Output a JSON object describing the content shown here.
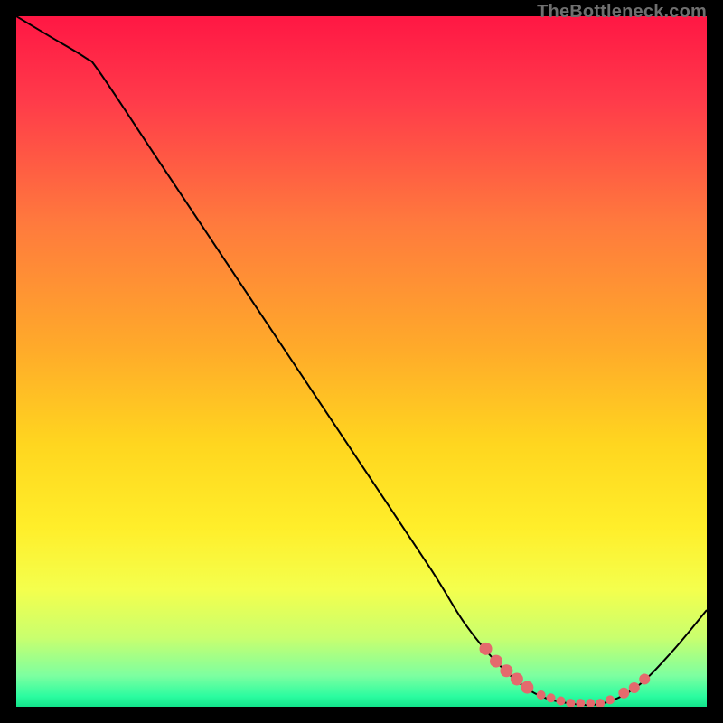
{
  "watermark": "TheBottleneck.com",
  "chart_data": {
    "type": "line",
    "title": "",
    "xlabel": "",
    "ylabel": "",
    "xlim": [
      0,
      100
    ],
    "ylim": [
      0,
      100
    ],
    "grid": false,
    "curve": [
      {
        "x": 0,
        "y": 100
      },
      {
        "x": 5,
        "y": 97
      },
      {
        "x": 10,
        "y": 94
      },
      {
        "x": 12,
        "y": 92
      },
      {
        "x": 20,
        "y": 80
      },
      {
        "x": 30,
        "y": 65
      },
      {
        "x": 40,
        "y": 50
      },
      {
        "x": 50,
        "y": 35
      },
      {
        "x": 60,
        "y": 20
      },
      {
        "x": 65,
        "y": 12
      },
      {
        "x": 70,
        "y": 6
      },
      {
        "x": 75,
        "y": 2
      },
      {
        "x": 80,
        "y": 0.5
      },
      {
        "x": 85,
        "y": 0.5
      },
      {
        "x": 90,
        "y": 3
      },
      {
        "x": 95,
        "y": 8
      },
      {
        "x": 100,
        "y": 14
      }
    ],
    "marker_clusters": [
      {
        "x_start": 68,
        "x_end": 74,
        "count": 5,
        "size": 7,
        "color": "#e46a6d"
      },
      {
        "x_start": 76,
        "x_end": 86,
        "count": 8,
        "size": 5,
        "color": "#e46a6d"
      },
      {
        "x_start": 88,
        "x_end": 91,
        "count": 3,
        "size": 6,
        "color": "#e46a6d"
      }
    ],
    "background_gradient": {
      "stops": [
        {
          "offset": 0.0,
          "color": "#ff1744"
        },
        {
          "offset": 0.12,
          "color": "#ff3a4a"
        },
        {
          "offset": 0.3,
          "color": "#ff7a3d"
        },
        {
          "offset": 0.48,
          "color": "#ffaa2a"
        },
        {
          "offset": 0.62,
          "color": "#ffd61f"
        },
        {
          "offset": 0.74,
          "color": "#ffee2a"
        },
        {
          "offset": 0.83,
          "color": "#f4ff4d"
        },
        {
          "offset": 0.9,
          "color": "#c9ff6e"
        },
        {
          "offset": 0.955,
          "color": "#7dffa0"
        },
        {
          "offset": 0.985,
          "color": "#2bfca0"
        },
        {
          "offset": 1.0,
          "color": "#12e38a"
        }
      ]
    }
  }
}
